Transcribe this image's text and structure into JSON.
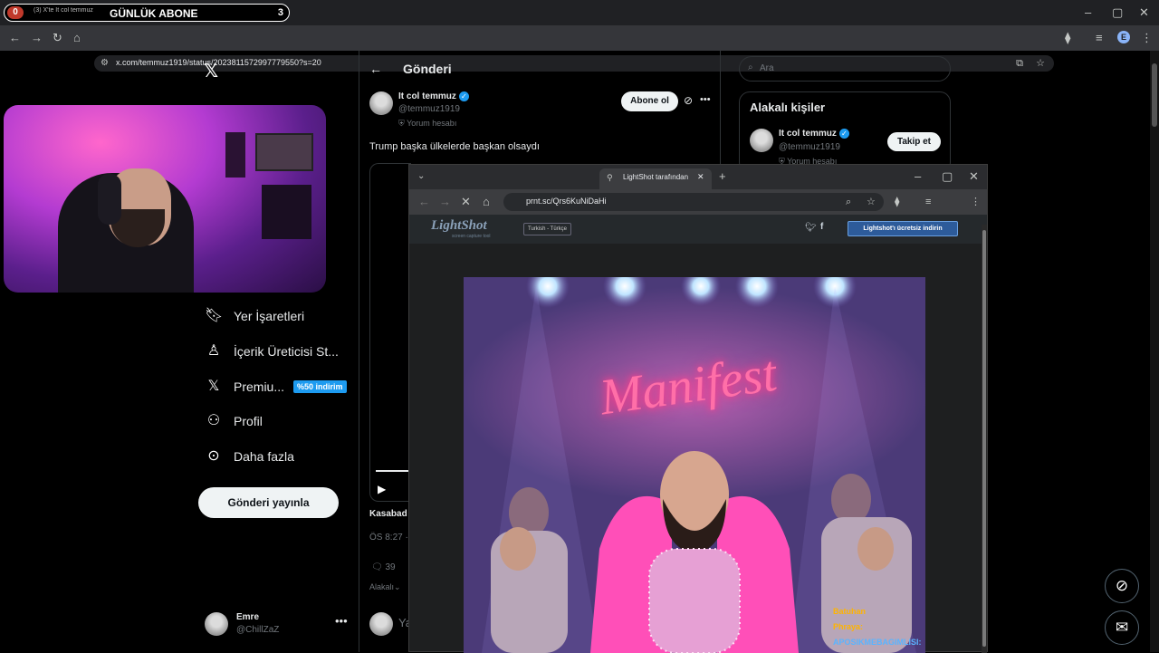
{
  "browser": {
    "tab_title": "(3) X'te It col temmuz",
    "url": "x.com/temmuz1919/status/2023811572997779550?s=20",
    "avatar_letter": "E"
  },
  "stream_overlay": {
    "left_count": "0",
    "label": "GÜNLÜK ABONE",
    "right_count": "3"
  },
  "sidebar": {
    "items": [
      {
        "icon": "bookmark-icon",
        "label": "Yer İşaretleri"
      },
      {
        "icon": "creator-studio-icon",
        "label": "İçerik Üreticisi St..."
      },
      {
        "icon": "x-premium-icon",
        "label": "Premiu..."
      },
      {
        "icon": "profile-icon",
        "label": "Profil"
      },
      {
        "icon": "more-icon",
        "label": "Daha fazla"
      }
    ],
    "premium_badge": "%50 indirim",
    "post_button": "Gönderi yayınla",
    "user": {
      "name": "Emre",
      "handle": "@ChillZaZ"
    }
  },
  "main": {
    "header_title": "Gönderi",
    "author": {
      "name": "It col temmuz",
      "handle": "@temmuz1919",
      "label": "Yorum hesabı"
    },
    "follow_button": "Abone ol",
    "post_text": "Trump başka ülkelerde başkan olsaydı",
    "partial_caption": "Kasabad",
    "timestamp": "ÖS 8:27 ·",
    "reply_count": "39",
    "sort_label": "Alakalı",
    "reply_placeholder": "Ya"
  },
  "right_col": {
    "search_placeholder": "Ara",
    "related_title": "Alakalı kişiler",
    "person": {
      "name": "It col temmuz",
      "handle": "@temmuz1919",
      "label": "Yorum hesabı"
    },
    "follow_button": "Takip et"
  },
  "lightshot": {
    "tab_title": "LightShot tarafından",
    "url": "prnt.sc/Qrs6KuNiDaHi",
    "brand": "LightShot",
    "brand_sub": "screen capture tool",
    "language": "Turkish - Türkçe",
    "download_button": "Lightshot'ı ücretsiz indirin",
    "image_text": "Manifest"
  },
  "chat": [
    {
      "user": "Batuhan",
      "color": "#ffb400"
    },
    {
      "user": "Phraya:",
      "color": "#ffb400"
    },
    {
      "user": "APOSIKMEBAGIMLISI:",
      "color": "#5ab4ff"
    }
  ]
}
